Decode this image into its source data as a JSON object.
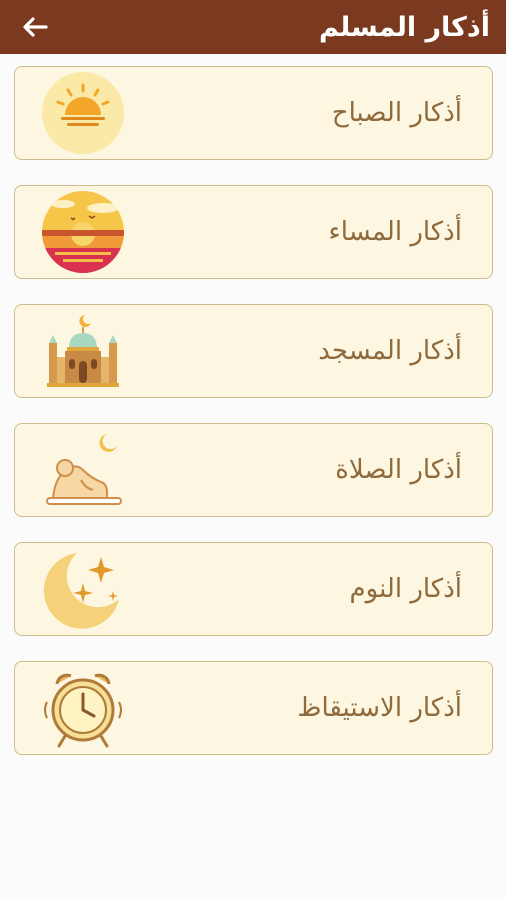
{
  "header": {
    "title": "أذكار المسلم",
    "back_icon": "arrow-left-icon",
    "background": "#7b3a1f"
  },
  "items": [
    {
      "label": "أذكار الصباح",
      "icon": "sunrise-icon"
    },
    {
      "label": "أذكار المساء",
      "icon": "sunset-icon"
    },
    {
      "label": "أذكار المسجد",
      "icon": "mosque-icon"
    },
    {
      "label": "أذكار الصلاة",
      "icon": "prayer-icon"
    },
    {
      "label": "أذكار النوم",
      "icon": "moon-stars-icon"
    },
    {
      "label": "أذكار الاستيقاظ",
      "icon": "alarm-clock-icon"
    }
  ],
  "colors": {
    "card_background": "#fdf6e1",
    "card_border": "#cdbd8b",
    "label_color": "#8e6a3c",
    "accent": "#f0c24a"
  }
}
